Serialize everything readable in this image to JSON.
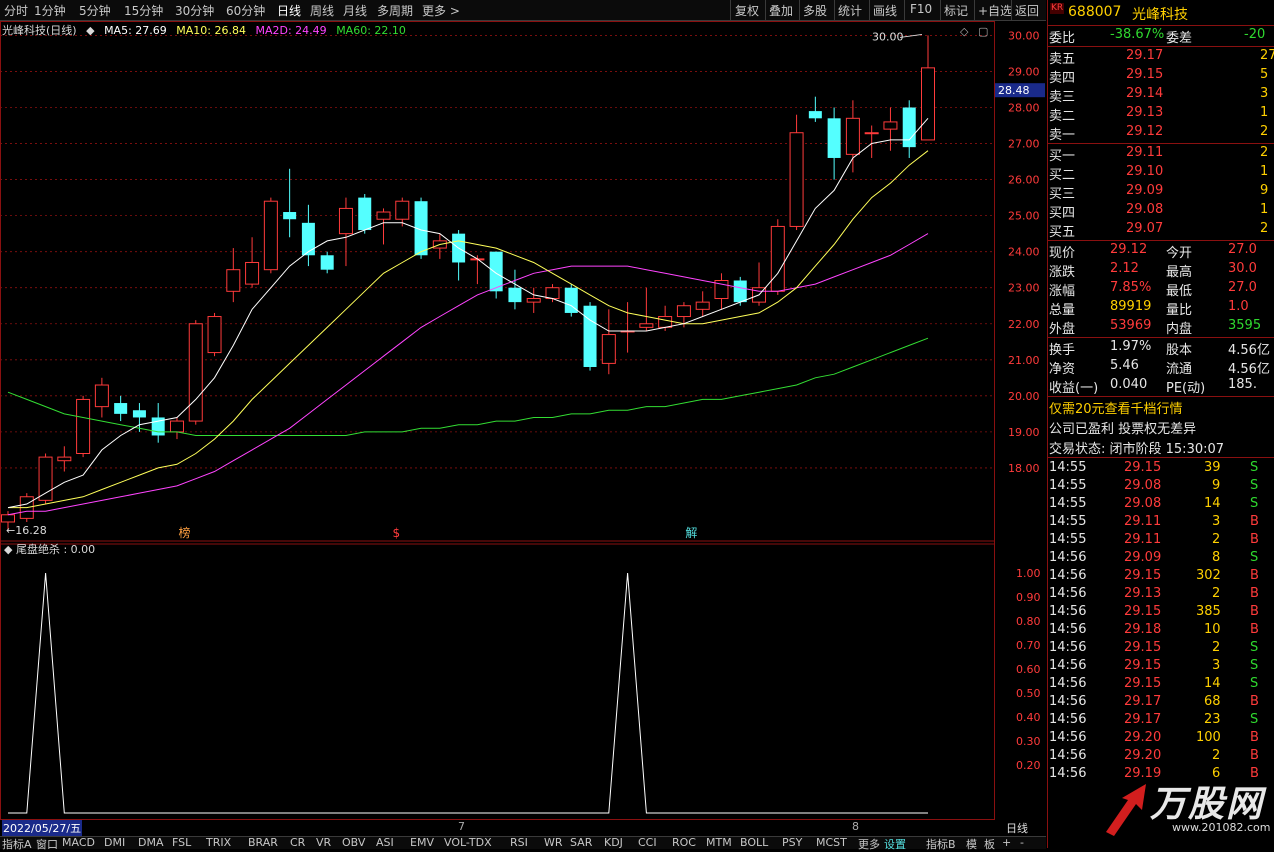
{
  "toolbar": {
    "left_items": [
      "分时",
      "1分钟",
      "5分钟",
      "15分钟",
      "30分钟",
      "60分钟",
      "日线",
      "周线",
      "月线",
      "多周期",
      "更多 >"
    ],
    "active": "日线",
    "right_items": [
      "复权",
      "叠加",
      "多股",
      "统计",
      "画线",
      "F10",
      "标记",
      "+自选",
      "返回"
    ]
  },
  "legend": {
    "title": "光峰科技(日线)",
    "ma5": "MA5: 27.69",
    "ma10": "MA10: 26.84",
    "ma20": "MA2D: 24.49",
    "ma60": "MA60: 22.10"
  },
  "colors": {
    "up": "#ff3b3b",
    "down": "#54ffff",
    "ma5": "#ffffff",
    "ma10": "#ffff5a",
    "ma20": "#ff44ff",
    "ma60": "#33dd33",
    "grid": "#8a1010"
  },
  "chart_data": {
    "type": "candlestick",
    "ylim": [
      16.0,
      30.4
    ],
    "y_ticks": [
      "30.00",
      "29.00",
      "28.00",
      "27.00",
      "26.00",
      "25.00",
      "24.00",
      "23.00",
      "22.00",
      "21.00",
      "20.00",
      "19.00",
      "18.00"
    ],
    "current_price_label": "28.48",
    "high_marker": "30.00",
    "low_marker": "16.28",
    "markers": [
      "榜",
      "$",
      "解"
    ],
    "candles": [
      [
        16.5,
        16.7,
        16.3,
        16.8
      ],
      [
        16.6,
        17.2,
        16.5,
        17.3
      ],
      [
        17.1,
        18.3,
        17.0,
        18.4
      ],
      [
        18.2,
        18.3,
        17.9,
        18.6
      ],
      [
        18.4,
        19.9,
        18.3,
        20.0
      ],
      [
        19.7,
        20.3,
        19.4,
        20.5
      ],
      [
        19.8,
        19.5,
        19.3,
        20.0
      ],
      [
        19.6,
        19.4,
        19.0,
        19.8
      ],
      [
        19.4,
        18.9,
        18.7,
        19.8
      ],
      [
        19.0,
        19.3,
        18.8,
        19.4
      ],
      [
        19.3,
        22.0,
        19.2,
        22.1
      ],
      [
        21.2,
        22.2,
        21.1,
        22.3
      ],
      [
        22.9,
        23.5,
        22.6,
        24.1
      ],
      [
        23.1,
        23.7,
        23.0,
        24.4
      ],
      [
        23.5,
        25.4,
        23.4,
        25.5
      ],
      [
        25.1,
        24.9,
        24.4,
        26.3
      ],
      [
        24.8,
        23.9,
        23.6,
        25.3
      ],
      [
        23.9,
        23.5,
        23.4,
        24.0
      ],
      [
        24.5,
        25.2,
        23.6,
        25.5
      ],
      [
        25.5,
        24.6,
        24.5,
        25.6
      ],
      [
        24.9,
        25.1,
        24.2,
        25.2
      ],
      [
        24.9,
        25.4,
        24.7,
        25.5
      ],
      [
        25.4,
        23.9,
        23.8,
        25.5
      ],
      [
        24.1,
        24.3,
        23.8,
        24.5
      ],
      [
        24.5,
        23.7,
        23.2,
        24.6
      ],
      [
        23.8,
        23.8,
        23.1,
        23.9
      ],
      [
        24.0,
        22.9,
        22.7,
        24.0
      ],
      [
        23.0,
        22.6,
        22.4,
        23.5
      ],
      [
        22.6,
        22.7,
        22.3,
        23.0
      ],
      [
        22.7,
        23.0,
        22.6,
        23.1
      ],
      [
        23.0,
        22.3,
        22.2,
        23.1
      ],
      [
        22.5,
        20.8,
        20.7,
        22.6
      ],
      [
        20.9,
        21.7,
        20.6,
        22.4
      ],
      [
        21.8,
        21.8,
        21.2,
        22.6
      ],
      [
        21.9,
        22.0,
        21.8,
        23.0
      ],
      [
        21.9,
        22.2,
        21.8,
        22.5
      ],
      [
        22.2,
        22.5,
        21.9,
        22.6
      ],
      [
        22.4,
        22.6,
        22.2,
        22.9
      ],
      [
        22.7,
        23.2,
        22.4,
        23.4
      ],
      [
        23.2,
        22.6,
        22.5,
        23.3
      ],
      [
        22.6,
        23.0,
        22.5,
        23.7
      ],
      [
        22.9,
        24.7,
        22.8,
        24.9
      ],
      [
        24.7,
        27.3,
        24.6,
        27.8
      ],
      [
        27.9,
        27.7,
        27.6,
        28.3
      ],
      [
        27.7,
        26.6,
        26.0,
        28.0
      ],
      [
        26.7,
        27.7,
        26.2,
        28.2
      ],
      [
        27.3,
        27.3,
        26.6,
        27.5
      ],
      [
        27.4,
        27.6,
        26.8,
        28.0
      ],
      [
        28.0,
        26.9,
        26.6,
        28.2
      ],
      [
        27.1,
        29.1,
        27.1,
        30.0
      ]
    ],
    "ma5": [
      16.9,
      17.0,
      17.3,
      17.6,
      17.8,
      18.5,
      18.9,
      19.2,
      19.3,
      19.4,
      19.9,
      20.5,
      21.4,
      22.4,
      23.0,
      23.6,
      24.0,
      24.3,
      24.4,
      24.6,
      24.8,
      24.8,
      24.6,
      24.5,
      24.1,
      23.8,
      23.4,
      23.1,
      22.8,
      22.7,
      22.5,
      22.1,
      21.8,
      21.8,
      21.8,
      21.9,
      22.0,
      22.2,
      22.4,
      22.6,
      22.8,
      23.4,
      24.3,
      25.2,
      25.7,
      26.6,
      27.0,
      27.1,
      27.1,
      27.7
    ],
    "ma10": [
      16.9,
      16.9,
      17.0,
      17.1,
      17.2,
      17.4,
      17.6,
      17.8,
      18.0,
      18.1,
      18.4,
      18.8,
      19.3,
      19.9,
      20.4,
      20.9,
      21.4,
      21.9,
      22.4,
      22.9,
      23.4,
      23.7,
      24.0,
      24.2,
      24.3,
      24.2,
      24.1,
      23.9,
      23.7,
      23.4,
      23.1,
      22.8,
      22.5,
      22.3,
      22.2,
      22.1,
      22.0,
      22.0,
      22.1,
      22.2,
      22.3,
      22.6,
      23.0,
      23.6,
      24.2,
      24.9,
      25.5,
      25.9,
      26.4,
      26.8
    ],
    "ma20": [
      16.7,
      16.8,
      16.8,
      16.9,
      17.0,
      17.1,
      17.2,
      17.3,
      17.4,
      17.5,
      17.7,
      17.9,
      18.2,
      18.5,
      18.8,
      19.1,
      19.5,
      19.9,
      20.3,
      20.7,
      21.1,
      21.5,
      21.9,
      22.2,
      22.5,
      22.8,
      23.0,
      23.2,
      23.4,
      23.5,
      23.6,
      23.6,
      23.6,
      23.6,
      23.5,
      23.4,
      23.3,
      23.2,
      23.1,
      23.0,
      22.9,
      22.9,
      23.0,
      23.1,
      23.3,
      23.5,
      23.7,
      23.9,
      24.2,
      24.5
    ],
    "ma60": [
      20.1,
      19.9,
      19.7,
      19.5,
      19.4,
      19.3,
      19.2,
      19.1,
      19.0,
      19.0,
      18.9,
      18.9,
      18.9,
      18.9,
      18.9,
      18.9,
      18.9,
      18.9,
      18.9,
      19.0,
      19.0,
      19.0,
      19.1,
      19.1,
      19.2,
      19.2,
      19.3,
      19.3,
      19.4,
      19.4,
      19.5,
      19.5,
      19.6,
      19.6,
      19.7,
      19.7,
      19.8,
      19.9,
      19.9,
      20.0,
      20.1,
      20.2,
      20.3,
      20.5,
      20.6,
      20.8,
      21.0,
      21.2,
      21.4,
      21.6
    ],
    "indicator": {
      "name": "尾盘绝杀 : 0.00",
      "ylim": [
        0,
        1.05
      ],
      "y_ticks": [
        "1.00",
        "0.90",
        "0.80",
        "0.70",
        "0.60",
        "0.50",
        "0.40",
        "0.30",
        "0.20"
      ],
      "spike_index": [
        2,
        33
      ]
    }
  },
  "date_bar": {
    "start": "2022/05/27/五",
    "month7": "7",
    "month8": "8",
    "period": "日线"
  },
  "bottom_tabs": [
    "指标A",
    "窗口",
    "MACD",
    "DMI",
    "DMA",
    "FSL",
    "TRIX",
    "BRAR",
    "CR",
    "VR",
    "OBV",
    "ASI",
    "EMV",
    "VOL-TDX",
    "RSI",
    "WR",
    "SAR",
    "KDJ",
    "CCI",
    "ROC",
    "MTM",
    "BOLL",
    "PSY",
    "MCST",
    "更多",
    "设置"
  ],
  "bottom_right": [
    "指标B",
    "模",
    "板",
    "+",
    "-"
  ],
  "quote": {
    "logo": "KR",
    "code": "688007",
    "name": "光峰科技",
    "weibi_label": "委比",
    "weibi": "-38.67%",
    "weicha_label": "委差",
    "weicha": "-20",
    "asks": [
      {
        "label": "卖五",
        "price": "29.17",
        "vol": "27"
      },
      {
        "label": "卖四",
        "price": "29.15",
        "vol": "5"
      },
      {
        "label": "卖三",
        "price": "29.14",
        "vol": "3"
      },
      {
        "label": "卖二",
        "price": "29.13",
        "vol": "1"
      },
      {
        "label": "卖一",
        "price": "29.12",
        "vol": "2"
      }
    ],
    "bids": [
      {
        "label": "买一",
        "price": "29.11",
        "vol": "2"
      },
      {
        "label": "买二",
        "price": "29.10",
        "vol": "1"
      },
      {
        "label": "买三",
        "price": "29.09",
        "vol": "9"
      },
      {
        "label": "买四",
        "price": "29.08",
        "vol": "1"
      },
      {
        "label": "买五",
        "price": "29.07",
        "vol": "2"
      }
    ],
    "stats": [
      {
        "l1": "现价",
        "v1": "29.12",
        "l2": "今开",
        "v2": "27.0"
      },
      {
        "l1": "涨跌",
        "v1": "2.12",
        "l2": "最高",
        "v2": "30.0"
      },
      {
        "l1": "涨幅",
        "v1": "7.85%",
        "l2": "最低",
        "v2": "27.0"
      },
      {
        "l1": "总量",
        "v1": "89919",
        "l2": "量比",
        "v2": "1.0"
      },
      {
        "l1": "外盘",
        "v1": "53969",
        "l2": "内盘",
        "v2": "3595"
      }
    ],
    "fin": [
      {
        "l1": "换手",
        "v1": "1.97%",
        "l2": "股本",
        "v2": "4.56亿"
      },
      {
        "l1": "净资",
        "v1": "5.46",
        "l2": "流通",
        "v2": "4.56亿"
      },
      {
        "l1": "收益(一)",
        "v1": "0.040",
        "l2": "PE(动)",
        "v2": "185."
      }
    ],
    "promo": "仅需20元查看千档行情",
    "notice": "公司已盈利 投票权无差异",
    "trade_state": "交易状态: 闭市阶段 15:30:07",
    "ticks": [
      {
        "t": "14:55",
        "p": "29.15",
        "v": "39",
        "s": "S"
      },
      {
        "t": "14:55",
        "p": "29.08",
        "v": "9",
        "s": "S"
      },
      {
        "t": "14:55",
        "p": "29.08",
        "v": "14",
        "s": "S"
      },
      {
        "t": "14:55",
        "p": "29.11",
        "v": "3",
        "s": "B"
      },
      {
        "t": "14:55",
        "p": "29.11",
        "v": "2",
        "s": "B"
      },
      {
        "t": "14:56",
        "p": "29.09",
        "v": "8",
        "s": "S"
      },
      {
        "t": "14:56",
        "p": "29.15",
        "v": "302",
        "s": "B"
      },
      {
        "t": "14:56",
        "p": "29.13",
        "v": "2",
        "s": "B"
      },
      {
        "t": "14:56",
        "p": "29.15",
        "v": "385",
        "s": "B"
      },
      {
        "t": "14:56",
        "p": "29.18",
        "v": "10",
        "s": "B"
      },
      {
        "t": "14:56",
        "p": "29.15",
        "v": "2",
        "s": "S"
      },
      {
        "t": "14:56",
        "p": "29.15",
        "v": "3",
        "s": "S"
      },
      {
        "t": "14:56",
        "p": "29.15",
        "v": "14",
        "s": "S"
      },
      {
        "t": "14:56",
        "p": "29.17",
        "v": "68",
        "s": "B"
      },
      {
        "t": "14:56",
        "p": "29.17",
        "v": "23",
        "s": "S"
      },
      {
        "t": "14:56",
        "p": "29.20",
        "v": "100",
        "s": "B"
      },
      {
        "t": "14:56",
        "p": "29.20",
        "v": "2",
        "s": "B"
      },
      {
        "t": "14:56",
        "p": "29.19",
        "v": "6",
        "s": "B"
      }
    ],
    "watermark": "万股网",
    "watermark_url": "www.201082.com"
  }
}
